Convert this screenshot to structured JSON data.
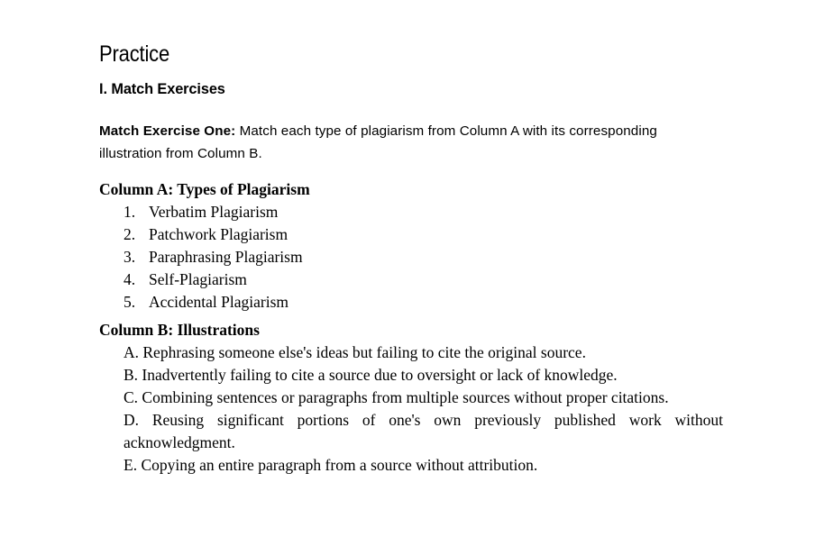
{
  "document": {
    "title": "Practice",
    "section_heading": "I. Match Exercises",
    "instruction": {
      "lead": "Match Exercise One:",
      "body": " Match each type of plagiarism from Column A with its corresponding illustration from Column B."
    },
    "column_a": {
      "heading": "Column A: Types of Plagiarism",
      "items": [
        {
          "num": "1.",
          "label": "Verbatim Plagiarism"
        },
        {
          "num": "2.",
          "label": "Patchwork Plagiarism"
        },
        {
          "num": "3.",
          "label": "Paraphrasing Plagiarism"
        },
        {
          "num": "4.",
          "label": "Self-Plagiarism"
        },
        {
          "num": "5.",
          "label": "Accidental Plagiarism"
        }
      ]
    },
    "column_b": {
      "heading": "Column B: Illustrations",
      "items": [
        {
          "letter": "A.",
          "text": "A. Rephrasing someone else's ideas but failing to cite the original source.",
          "wraps": false
        },
        {
          "letter": "B.",
          "text": "B. Inadvertently failing to cite a source due to oversight or lack of knowledge.",
          "wraps": false
        },
        {
          "letter": "C.",
          "text": "C. Combining sentences or paragraphs from multiple sources without proper citations.",
          "wraps": true
        },
        {
          "letter": "D.",
          "text": "D. Reusing significant portions of one's own previously published work without acknowledgment.",
          "wraps": true
        },
        {
          "letter": "E.",
          "text": "E. Copying an entire paragraph from a source without attribution.",
          "wraps": false
        }
      ]
    }
  },
  "colors": {
    "page_background": "#ffffff",
    "text": "#000000"
  }
}
